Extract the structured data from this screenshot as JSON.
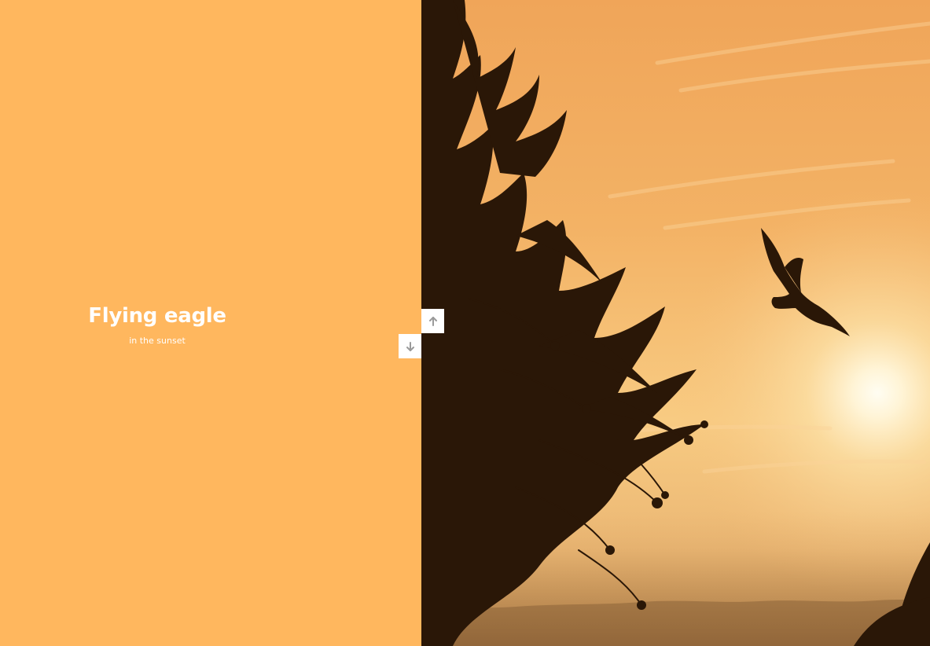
{
  "slide": {
    "title": "Flying eagle",
    "subtitle": "in the sunset"
  },
  "colors": {
    "panel_background": "#FFB75E",
    "caption_text": "#FFFFFF",
    "button_background": "#FFFFFF",
    "button_icon": "#9A9A9A"
  },
  "navigation": {
    "up_icon": "arrow-up-icon",
    "down_icon": "arrow-down-icon"
  },
  "image": {
    "subject": "eagle-silhouette-sunset-photo"
  }
}
